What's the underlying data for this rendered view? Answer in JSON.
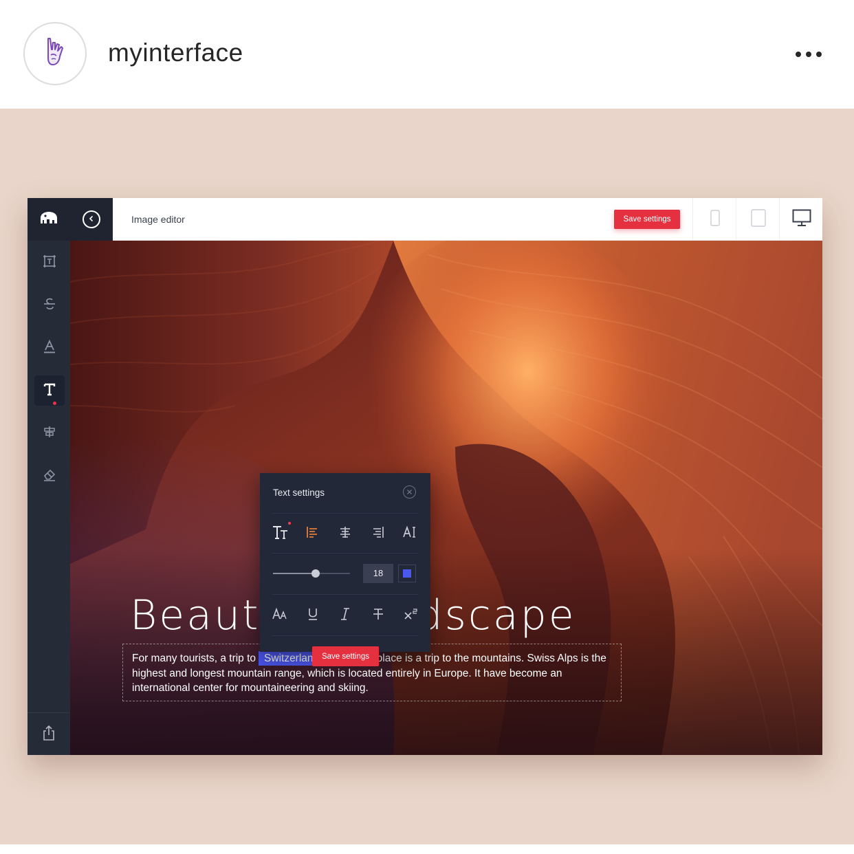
{
  "post_header": {
    "username": "myinterface",
    "avatar_icon": "rock-hand-icon",
    "more_icon": "more-horizontal-icon"
  },
  "colors": {
    "post_background": "#ead5ca",
    "sidebar": "#262b38",
    "accent_red": "#e5303f",
    "highlight_blue": "#4b57ee",
    "panel_background": "#232838"
  },
  "editor": {
    "title": "Image editor",
    "save_label": "Save settings",
    "logo_icon": "elephant-logo-icon",
    "back_icon": "chevron-left-icon",
    "devices": [
      "phone-icon",
      "tablet-icon",
      "desktop-icon"
    ],
    "active_device": "desktop-icon",
    "sidebar_tools": [
      "frame-icon",
      "strikethrough-icon",
      "text-color-icon",
      "text-icon",
      "align-center-icon",
      "eraser-icon"
    ],
    "active_tool": "text-icon",
    "export_icon": "share-icon"
  },
  "canvas": {
    "headline": "Beautiful landscape",
    "paragraph_before": "For many tourists, a trip to",
    "highlighted_word": "Switzerland",
    "paragraph_after": "in the first place is a trip to the mountains. Swiss Alps is the highest and longest mountain range, which is located entirely in Europe. It have become an international center for mountaineering and skiing."
  },
  "text_settings": {
    "title": "Text settings",
    "row1_tools": [
      "font-size-icon",
      "align-left-icon",
      "align-center-icon",
      "align-right-icon",
      "letter-spacing-icon"
    ],
    "row2": {
      "slider_value": 0.55,
      "size": "18",
      "color": "#4b57ee"
    },
    "row3_tools": [
      "case-icon",
      "underline-icon",
      "italic-icon",
      "strikethrough-icon",
      "superscript-icon"
    ],
    "save_label": "Save settings"
  }
}
